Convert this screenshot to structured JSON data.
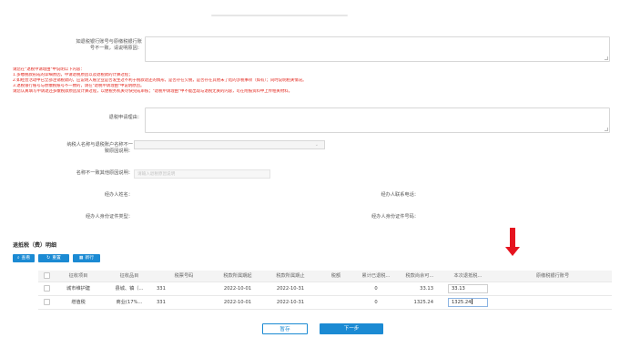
{
  "form": {
    "mismatch_label": "如退税银行账号与原缴税银行账\n号不一致，请说明原因：",
    "notes": [
      "请您在\"退税申请理由\"中说明以下内容：",
      "1.多缴税款形成的详细原因，申请退税原因以及退税款的计算过程；",
      "2.如经营活动中已全部注销税款的，应说明入账企业是否发生过不利于税款退还的情形，是否存在欠税，是否存在其他未了结的涉税事项（如有）；同时说明相关情况。",
      "3.退税银行账号与原缴税账号不一致的，请在\"退税申请理由\"中说明原因。",
      "请您认真填写申请退还多缴税款原因及计算过程，以便税务机关尽快完成审核；\"退税申请理由\"中不能出现与退税无关的内容，可在附报资料中上传相关材料。"
    ],
    "reason_label": "退税申请理由：",
    "name_mismatch_label": "纳税人名称与退税账户名称不一\n致原因说明：",
    "other_reason_label": "名称不一致其他原因说明：",
    "other_reason_placeholder": "请输入退税原因说明",
    "handler_name_label": "经办人姓名：",
    "handler_phone_label": "经办人联系电话：",
    "handler_id_type_label": "经办人身份证件类型：",
    "handler_id_no_label": "经办人身份证件号码："
  },
  "grid": {
    "title": "退抵税（费）明细",
    "buttons": {
      "query": "查看",
      "reset": "重置",
      "select": "新行"
    },
    "columns": [
      "征收项目",
      "征收品目",
      "税票号码",
      "税款所属期起",
      "税款所属期止",
      "税额",
      "累计已退税...",
      "税款尚余可...",
      "本次退抵税...",
      "原缴税银行账号"
    ],
    "rows": [
      {
        "item": "城市维护建",
        "subitem": "县城、镇（...",
        "ticket": "331",
        "start": "2022-10-01",
        "end": "2022-10-31",
        "amount": "",
        "refunded": "0",
        "remaining": "33.13",
        "current": "33.13",
        "account": ""
      },
      {
        "item": "增值税",
        "subitem": "商业(17%...",
        "ticket": "331",
        "start": "2022-10-01",
        "end": "2022-10-31",
        "amount": "",
        "refunded": "0",
        "remaining": "1325.24",
        "current": "1325.24",
        "account": ""
      }
    ]
  },
  "footer": {
    "save": "暂存",
    "next": "下一步"
  },
  "colors": {
    "accent": "#1b8ad3",
    "notice": "#e2231a",
    "arrow": "#e5141f"
  },
  "icons": {
    "query": "search-icon",
    "reset": "refresh-icon",
    "select": "grid-icon",
    "annotation": "red-down-arrow"
  }
}
